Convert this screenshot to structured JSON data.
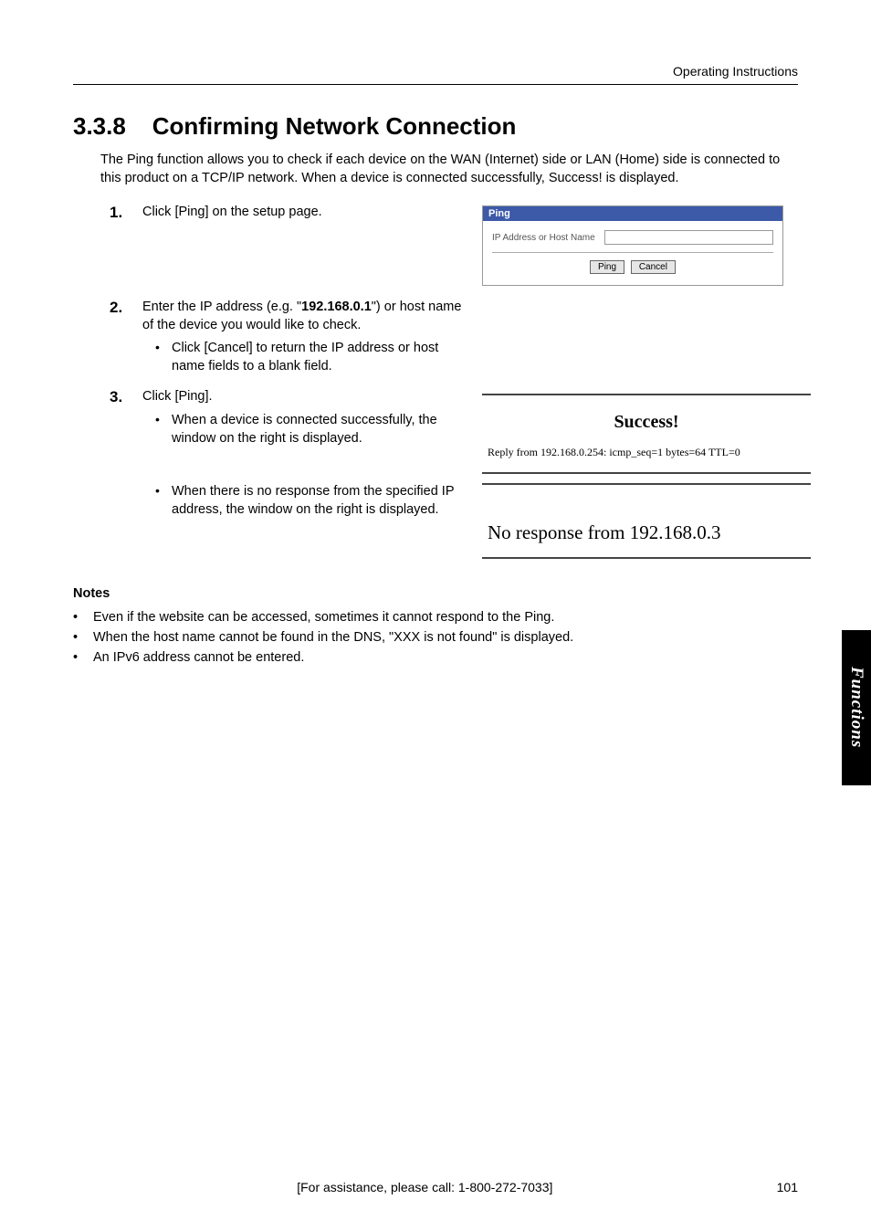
{
  "running_header": "Operating Instructions",
  "section": {
    "number": "3.3.8",
    "title": "Confirming Network Connection"
  },
  "intro": "The Ping function allows you to check if each device on the WAN (Internet) side or LAN (Home) side is connected to this product on a TCP/IP network. When a device is connected successfully, Success! is displayed.",
  "steps": {
    "s1": {
      "num": "1.",
      "text": "Click [Ping] on the setup page."
    },
    "s2": {
      "num": "2.",
      "text_before": "Enter the IP address (e.g. \"",
      "bold": "192.168.0.1",
      "text_after": "\") or host name of the device you would like to check.",
      "sub": "Click [Cancel] to return the IP address or host name fields to a blank field."
    },
    "s3": {
      "num": "3.",
      "text": "Click [Ping].",
      "sub_success": "When a device is connected successfully, the window on the right is displayed.",
      "sub_fail": "When there is no response from the specified IP address, the window on the right is displayed."
    }
  },
  "ping_dialog": {
    "title": "Ping",
    "field_label": "IP Address or Host Name",
    "input_value": "",
    "btn_ping": "Ping",
    "btn_cancel": "Cancel"
  },
  "result_success": {
    "heading": "Success!",
    "detail": "Reply from 192.168.0.254: icmp_seq=1 bytes=64 TTL=0"
  },
  "result_fail": {
    "heading": "No response from 192.168.0.3"
  },
  "notes": {
    "head": "Notes",
    "items": [
      "Even if the website can be accessed, sometimes it cannot respond to the Ping.",
      "When the host name cannot be found in the DNS, \"XXX is not found\" is displayed.",
      "An IPv6 address cannot be entered."
    ]
  },
  "side_tab": "Functions",
  "footer": {
    "center": "[For assistance, please call: 1-800-272-7033]",
    "page": "101"
  }
}
